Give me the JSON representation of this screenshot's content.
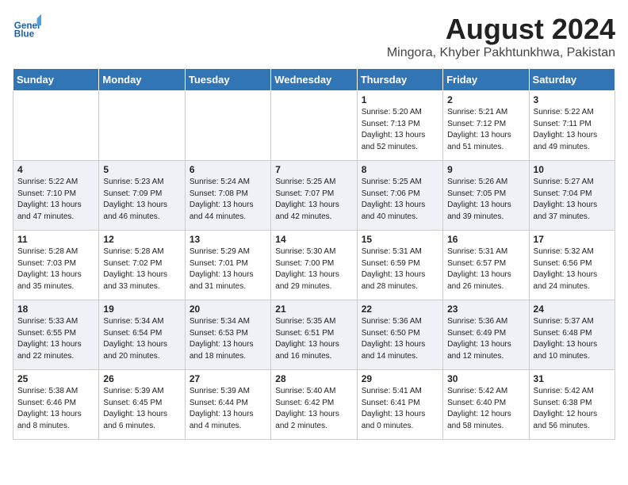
{
  "header": {
    "logo_line1": "General",
    "logo_line2": "Blue",
    "title": "August 2024",
    "subtitle": "Mingora, Khyber Pakhtunkhwa, Pakistan"
  },
  "weekdays": [
    "Sunday",
    "Monday",
    "Tuesday",
    "Wednesday",
    "Thursday",
    "Friday",
    "Saturday"
  ],
  "weeks": [
    [
      {
        "day": "",
        "info": ""
      },
      {
        "day": "",
        "info": ""
      },
      {
        "day": "",
        "info": ""
      },
      {
        "day": "",
        "info": ""
      },
      {
        "day": "1",
        "info": "Sunrise: 5:20 AM\nSunset: 7:13 PM\nDaylight: 13 hours\nand 52 minutes."
      },
      {
        "day": "2",
        "info": "Sunrise: 5:21 AM\nSunset: 7:12 PM\nDaylight: 13 hours\nand 51 minutes."
      },
      {
        "day": "3",
        "info": "Sunrise: 5:22 AM\nSunset: 7:11 PM\nDaylight: 13 hours\nand 49 minutes."
      }
    ],
    [
      {
        "day": "4",
        "info": "Sunrise: 5:22 AM\nSunset: 7:10 PM\nDaylight: 13 hours\nand 47 minutes."
      },
      {
        "day": "5",
        "info": "Sunrise: 5:23 AM\nSunset: 7:09 PM\nDaylight: 13 hours\nand 46 minutes."
      },
      {
        "day": "6",
        "info": "Sunrise: 5:24 AM\nSunset: 7:08 PM\nDaylight: 13 hours\nand 44 minutes."
      },
      {
        "day": "7",
        "info": "Sunrise: 5:25 AM\nSunset: 7:07 PM\nDaylight: 13 hours\nand 42 minutes."
      },
      {
        "day": "8",
        "info": "Sunrise: 5:25 AM\nSunset: 7:06 PM\nDaylight: 13 hours\nand 40 minutes."
      },
      {
        "day": "9",
        "info": "Sunrise: 5:26 AM\nSunset: 7:05 PM\nDaylight: 13 hours\nand 39 minutes."
      },
      {
        "day": "10",
        "info": "Sunrise: 5:27 AM\nSunset: 7:04 PM\nDaylight: 13 hours\nand 37 minutes."
      }
    ],
    [
      {
        "day": "11",
        "info": "Sunrise: 5:28 AM\nSunset: 7:03 PM\nDaylight: 13 hours\nand 35 minutes."
      },
      {
        "day": "12",
        "info": "Sunrise: 5:28 AM\nSunset: 7:02 PM\nDaylight: 13 hours\nand 33 minutes."
      },
      {
        "day": "13",
        "info": "Sunrise: 5:29 AM\nSunset: 7:01 PM\nDaylight: 13 hours\nand 31 minutes."
      },
      {
        "day": "14",
        "info": "Sunrise: 5:30 AM\nSunset: 7:00 PM\nDaylight: 13 hours\nand 29 minutes."
      },
      {
        "day": "15",
        "info": "Sunrise: 5:31 AM\nSunset: 6:59 PM\nDaylight: 13 hours\nand 28 minutes."
      },
      {
        "day": "16",
        "info": "Sunrise: 5:31 AM\nSunset: 6:57 PM\nDaylight: 13 hours\nand 26 minutes."
      },
      {
        "day": "17",
        "info": "Sunrise: 5:32 AM\nSunset: 6:56 PM\nDaylight: 13 hours\nand 24 minutes."
      }
    ],
    [
      {
        "day": "18",
        "info": "Sunrise: 5:33 AM\nSunset: 6:55 PM\nDaylight: 13 hours\nand 22 minutes."
      },
      {
        "day": "19",
        "info": "Sunrise: 5:34 AM\nSunset: 6:54 PM\nDaylight: 13 hours\nand 20 minutes."
      },
      {
        "day": "20",
        "info": "Sunrise: 5:34 AM\nSunset: 6:53 PM\nDaylight: 13 hours\nand 18 minutes."
      },
      {
        "day": "21",
        "info": "Sunrise: 5:35 AM\nSunset: 6:51 PM\nDaylight: 13 hours\nand 16 minutes."
      },
      {
        "day": "22",
        "info": "Sunrise: 5:36 AM\nSunset: 6:50 PM\nDaylight: 13 hours\nand 14 minutes."
      },
      {
        "day": "23",
        "info": "Sunrise: 5:36 AM\nSunset: 6:49 PM\nDaylight: 13 hours\nand 12 minutes."
      },
      {
        "day": "24",
        "info": "Sunrise: 5:37 AM\nSunset: 6:48 PM\nDaylight: 13 hours\nand 10 minutes."
      }
    ],
    [
      {
        "day": "25",
        "info": "Sunrise: 5:38 AM\nSunset: 6:46 PM\nDaylight: 13 hours\nand 8 minutes."
      },
      {
        "day": "26",
        "info": "Sunrise: 5:39 AM\nSunset: 6:45 PM\nDaylight: 13 hours\nand 6 minutes."
      },
      {
        "day": "27",
        "info": "Sunrise: 5:39 AM\nSunset: 6:44 PM\nDaylight: 13 hours\nand 4 minutes."
      },
      {
        "day": "28",
        "info": "Sunrise: 5:40 AM\nSunset: 6:42 PM\nDaylight: 13 hours\nand 2 minutes."
      },
      {
        "day": "29",
        "info": "Sunrise: 5:41 AM\nSunset: 6:41 PM\nDaylight: 13 hours\nand 0 minutes."
      },
      {
        "day": "30",
        "info": "Sunrise: 5:42 AM\nSunset: 6:40 PM\nDaylight: 12 hours\nand 58 minutes."
      },
      {
        "day": "31",
        "info": "Sunrise: 5:42 AM\nSunset: 6:38 PM\nDaylight: 12 hours\nand 56 minutes."
      }
    ]
  ]
}
